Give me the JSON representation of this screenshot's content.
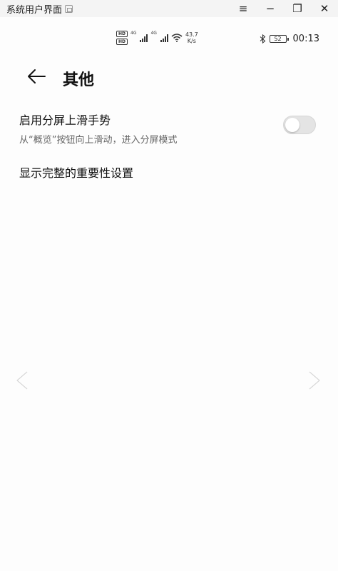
{
  "window": {
    "title": "系统用户界面",
    "controls": [
      "≡",
      "−",
      "❐",
      "✕"
    ]
  },
  "status_bar": {
    "hd1": "HD",
    "hd2": "HD",
    "sig1": "4G",
    "sig2": "4G",
    "speed_value": "43.7",
    "speed_unit": "K/s",
    "battery": "52",
    "time": "00:13"
  },
  "header": {
    "title": "其他",
    "back_icon": "arrow-left-icon"
  },
  "settings": {
    "split_screen": {
      "title": "启用分屏上滑手势",
      "subtitle": "从“概览”按钮向上滑动，进入分屏模式",
      "enabled": false
    },
    "importance": {
      "title": "显示完整的重要性设置"
    }
  },
  "colors": {
    "background": "#fdfdfd",
    "toggle_off": "#e4e4e4",
    "subtitle": "#666666"
  }
}
